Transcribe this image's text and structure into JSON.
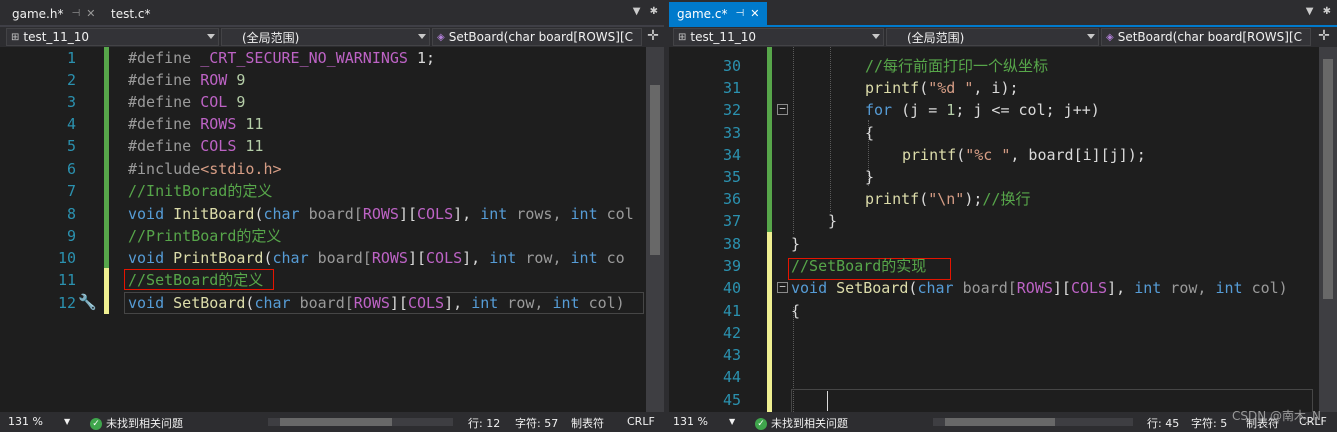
{
  "left": {
    "tabs": [
      {
        "label": "game.h*",
        "pin": "⊣",
        "close": "✕"
      },
      {
        "label": "test.c*"
      }
    ],
    "nav": {
      "project": "test_11_10",
      "scope": "(全局范围)",
      "member": "SetBoard(char board[ROWS][C"
    },
    "lines": [
      {
        "n": "1"
      },
      {
        "n": "2"
      },
      {
        "n": "3"
      },
      {
        "n": "4"
      },
      {
        "n": "5"
      },
      {
        "n": "6"
      },
      {
        "n": "7"
      },
      {
        "n": "8"
      },
      {
        "n": "9"
      },
      {
        "n": "10"
      },
      {
        "n": "11"
      },
      {
        "n": "12"
      }
    ],
    "code": {
      "l1a": "#define ",
      "l1b": "_CRT_SECURE_NO_WARNINGS",
      "l1c": " 1;",
      "l2a": "#define ",
      "l2b": "ROW",
      "l2c": " 9",
      "l3a": "#define ",
      "l3b": "COL",
      "l3c": " 9",
      "l4a": "#define ",
      "l4b": "ROWS",
      "l4c": " 11",
      "l5a": "#define ",
      "l5b": "COLS",
      "l5c": " 11",
      "l6a": "#include",
      "l6b": "<stdio.h>",
      "l7": "//InitBorad的定义",
      "l8a": "void",
      "l8b": " InitBoard",
      "l8c": "(",
      "l8d": "char",
      "l8e": " board[",
      "l8f": "ROWS",
      "l8g": "][",
      "l8h": "COLS",
      "l8i": "], ",
      "l8j": "int",
      "l8k": " rows, ",
      "l8l": "int",
      "l8m": " col",
      "l9": "//PrintBoard的定义",
      "l10a": "void",
      "l10b": " PrintBoard",
      "l10c": "(",
      "l10d": "char",
      "l10e": " board[",
      "l10f": "ROWS",
      "l10g": "][",
      "l10h": "COLS",
      "l10i": "], ",
      "l10j": "int",
      "l10k": " row, ",
      "l10l": "int",
      "l10m": " co",
      "l11": "//SetBoard的定义",
      "l12a": "void",
      "l12b": " SetBoard",
      "l12c": "(",
      "l12d": "char",
      "l12e": " board[",
      "l12f": "ROWS",
      "l12g": "][",
      "l12h": "COLS",
      "l12i": "], ",
      "l12j": "int",
      "l12k": " row, ",
      "l12l": "int",
      "l12m": " col)"
    },
    "status": {
      "zoom": "131 %",
      "issues": "未找到相关问题",
      "line": "行: 12",
      "char": "字符: 57",
      "tabs": "制表符",
      "eol": "CRLF"
    }
  },
  "right": {
    "tabs": [
      {
        "label": "game.c*",
        "pin": "⊣",
        "close": "✕"
      }
    ],
    "nav": {
      "project": "test_11_10",
      "scope": "(全局范围)",
      "member": "SetBoard(char board[ROWS][C"
    },
    "lines": [
      {
        "n": "30"
      },
      {
        "n": "31"
      },
      {
        "n": "32"
      },
      {
        "n": "33"
      },
      {
        "n": "34"
      },
      {
        "n": "35"
      },
      {
        "n": "36"
      },
      {
        "n": "37"
      },
      {
        "n": "38"
      },
      {
        "n": "39"
      },
      {
        "n": "40"
      },
      {
        "n": "41"
      },
      {
        "n": "42"
      },
      {
        "n": "43"
      },
      {
        "n": "44"
      },
      {
        "n": "45"
      }
    ],
    "code": {
      "l30": "//每行前面打印一个纵坐标",
      "l31a": "printf",
      "l31b": "(",
      "l31c": "\"%d \"",
      "l31d": ", i);",
      "l32a": "for",
      "l32b": " (j = ",
      "l32c": "1",
      "l32d": "; j <= col; j++)",
      "l33": "{",
      "l34a": "printf",
      "l34b": "(",
      "l34c": "\"%c \"",
      "l34d": ", board[i][j]);",
      "l35": "}",
      "l36a": "printf",
      "l36b": "(",
      "l36c": "\"\\n\"",
      "l36d": ");",
      "l36e": "//换行",
      "l37": "}",
      "l38": "}",
      "l39": "//SetBoard的实现",
      "l40a": "void",
      "l40b": " SetBoard",
      "l40c": "(",
      "l40d": "char",
      "l40e": " board[",
      "l40f": "ROWS",
      "l40g": "][",
      "l40h": "COLS",
      "l40i": "], ",
      "l40j": "int",
      "l40k": " row, ",
      "l40l": "int",
      "l40m": " col)",
      "l41": "{"
    },
    "status": {
      "zoom": "131 %",
      "issues": "未找到相关问题",
      "line": "行: 45",
      "char": "字符: 5",
      "tabs": "制表符",
      "eol": "CRLF"
    }
  },
  "watermark": "CSDN @南木_N",
  "colors": {
    "accent": "#007acc",
    "keyword": "#569cd6",
    "comment": "#57a64a",
    "function": "#dcdcaa",
    "macro": "#bd63c5",
    "string": "#d69d85",
    "number": "#b5cea8",
    "linenum": "#2b91af",
    "highlight_box": "#e51400"
  }
}
